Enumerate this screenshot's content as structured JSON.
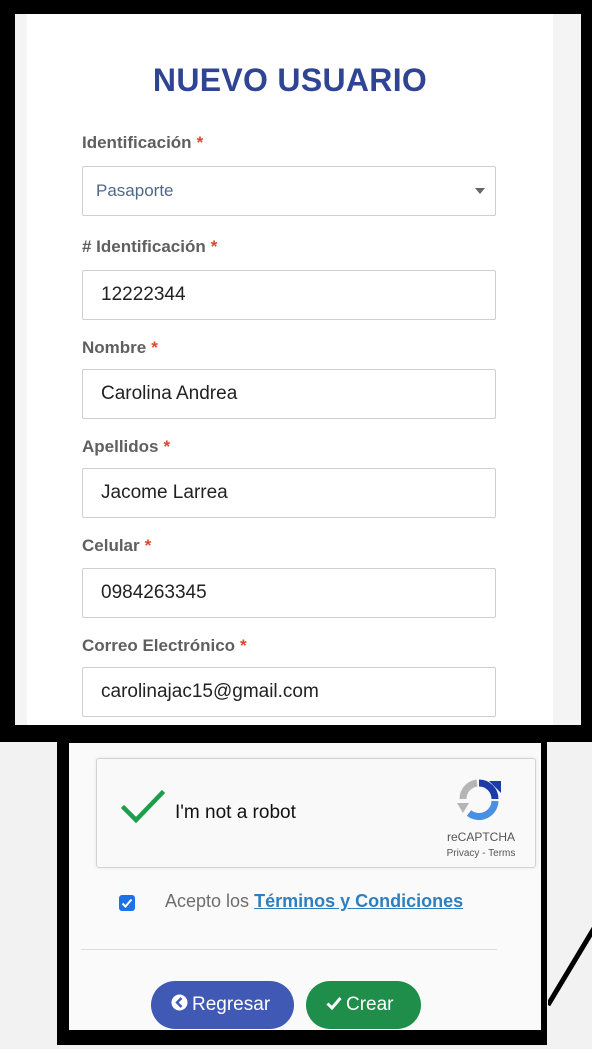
{
  "form": {
    "title": "NUEVO USUARIO",
    "required_mark": "*",
    "fields": {
      "identificacion": {
        "label": "Identificación",
        "value": "Pasaporte"
      },
      "numero": {
        "label": "# Identificación",
        "value": "12222344"
      },
      "nombre": {
        "label": "Nombre",
        "value": "Carolina Andrea"
      },
      "apellidos": {
        "label": "Apellidos",
        "value": "Jacome Larrea"
      },
      "celular": {
        "label": "Celular",
        "value": "0984263345"
      },
      "correo": {
        "label": "Correo Electrónico",
        "value": "carolinajac15@gmail.com"
      }
    }
  },
  "captcha": {
    "text": "I'm not a robot",
    "brand": "reCAPTCHA",
    "links": "Privacy - Terms",
    "checked": true
  },
  "terms": {
    "prefix": "Acepto los",
    "link": "Términos y Condiciones",
    "checked": true
  },
  "buttons": {
    "back": "Regresar",
    "create": "Crear"
  },
  "colors": {
    "title": "#2f4594",
    "required": "#d9472b",
    "back_button": "#3f59b4",
    "create_button": "#1e8e4a",
    "link": "#2d7fbf"
  },
  "icons": {
    "select": "chevron-down-icon",
    "captcha_check": "checkmark-icon",
    "captcha_logo": "recaptcha-logo-icon",
    "back": "arrow-left-circle-icon",
    "create": "check-icon"
  }
}
